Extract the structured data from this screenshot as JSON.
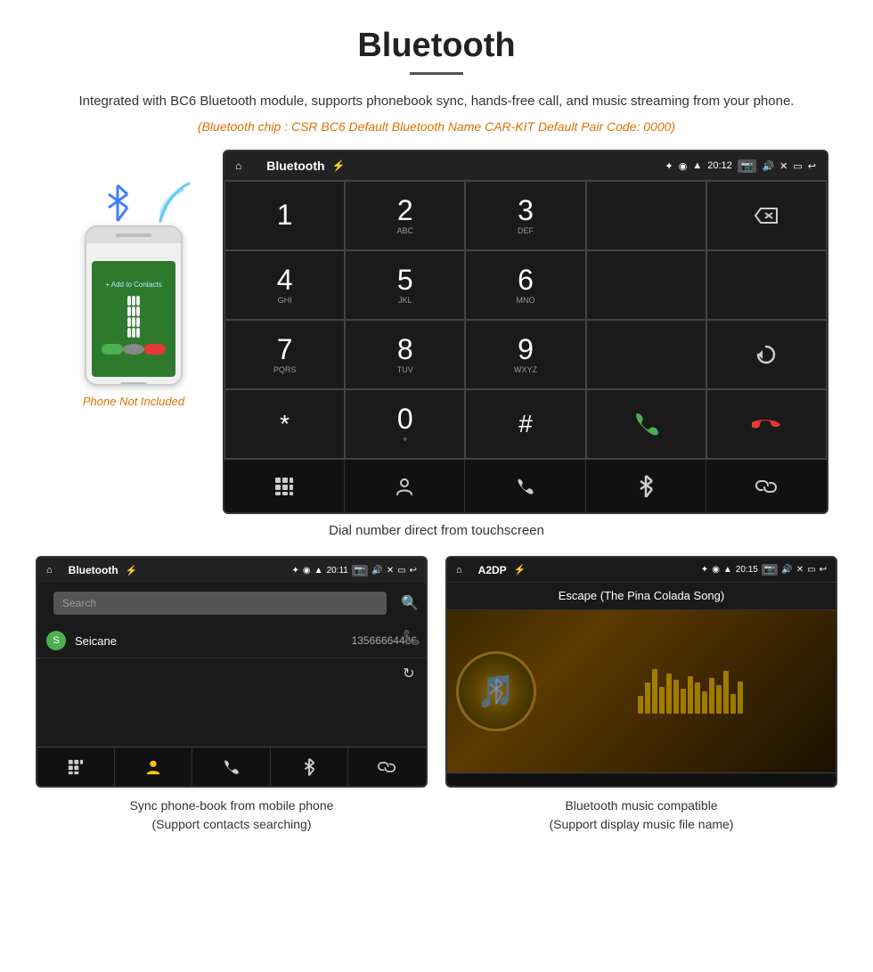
{
  "header": {
    "title": "Bluetooth",
    "underline": true,
    "description": "Integrated with BC6 Bluetooth module, supports phonebook sync, hands-free call, and music streaming from your phone.",
    "specs": "(Bluetooth chip : CSR BC6    Default Bluetooth Name CAR-KIT    Default Pair Code: 0000)"
  },
  "phone_label": "Phone Not Included",
  "dialpad": {
    "statusbar": {
      "title": "Bluetooth",
      "time": "20:12"
    },
    "keys": [
      {
        "main": "1",
        "sub": ""
      },
      {
        "main": "2",
        "sub": "ABC"
      },
      {
        "main": "3",
        "sub": "DEF"
      },
      {
        "main": "",
        "sub": ""
      },
      {
        "main": "⌫",
        "sub": ""
      },
      {
        "main": "4",
        "sub": "GHI"
      },
      {
        "main": "5",
        "sub": "JKL"
      },
      {
        "main": "6",
        "sub": "MNO"
      },
      {
        "main": "",
        "sub": ""
      },
      {
        "main": "",
        "sub": ""
      },
      {
        "main": "7",
        "sub": "PQRS"
      },
      {
        "main": "8",
        "sub": "TUV"
      },
      {
        "main": "9",
        "sub": "WXYZ"
      },
      {
        "main": "",
        "sub": ""
      },
      {
        "main": "↻",
        "sub": ""
      },
      {
        "main": "*",
        "sub": ""
      },
      {
        "main": "0",
        "sub": "+"
      },
      {
        "main": "#",
        "sub": ""
      },
      {
        "main": "✆green",
        "sub": ""
      },
      {
        "main": "✆red",
        "sub": ""
      }
    ]
  },
  "dial_caption": "Dial number direct from touchscreen",
  "phonebook": {
    "statusbar_title": "Bluetooth",
    "statusbar_time": "20:11",
    "search_placeholder": "Search",
    "contact_name": "Seicane",
    "contact_number": "13566664466"
  },
  "music": {
    "statusbar_title": "A2DP",
    "statusbar_time": "20:15",
    "song_title": "Escape (The Pina Colada Song)"
  },
  "captions": {
    "phonebook": "Sync phone-book from mobile phone\n(Support contacts searching)",
    "music": "Bluetooth music compatible\n(Support display music file name)"
  },
  "equalizer_bars": [
    20,
    35,
    50,
    30,
    45,
    38,
    28,
    42,
    35,
    25,
    40,
    32,
    48,
    22,
    36
  ],
  "icons": {
    "home": "⌂",
    "back": "↩",
    "usb": "⚡",
    "bluetooth": "✦",
    "wifi_signal": "▲",
    "battery": "▮",
    "camera": "📷",
    "volume": "🔊",
    "grid": "⊞",
    "person": "👤",
    "phone": "📞",
    "link": "🔗"
  }
}
